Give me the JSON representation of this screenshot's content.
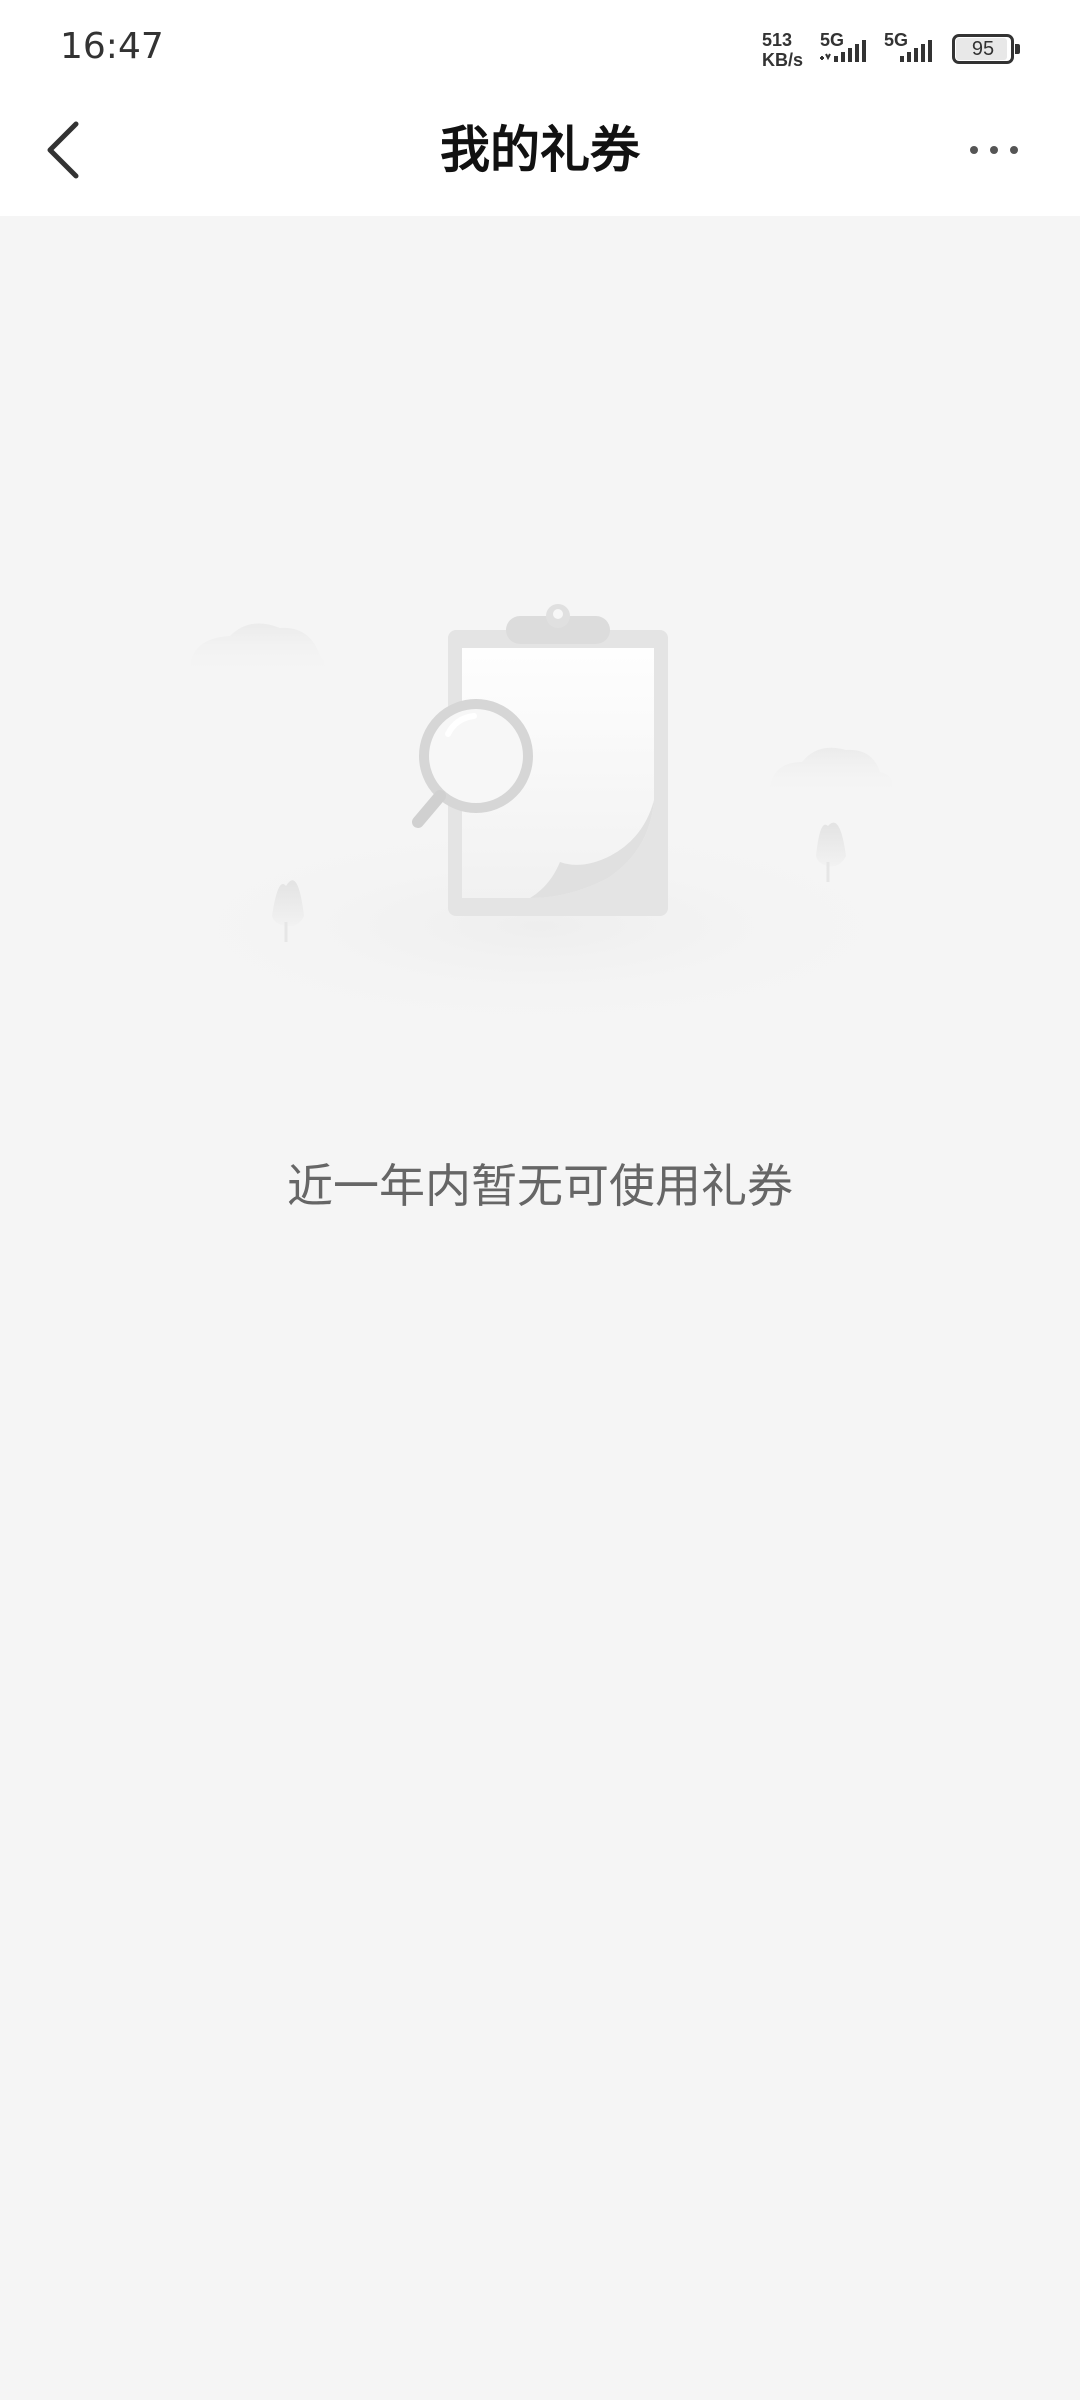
{
  "status_bar": {
    "time": "16:47",
    "net_speed_value": "513",
    "net_speed_unit": "KB/s",
    "signal_1_label": "5G",
    "signal_2_label": "5G",
    "battery_percent": "95",
    "battery_level": 0.95
  },
  "nav": {
    "title": "我的礼券",
    "back_icon": "chevron-left-icon",
    "more_icon": "more-dots-icon"
  },
  "empty_state": {
    "illustration": "clipboard-magnifier-illustration",
    "message": "近一年内暂无可使用礼券"
  },
  "colors": {
    "background": "#f5f5f5",
    "header": "#ffffff",
    "title": "#111111",
    "message": "#666666"
  }
}
